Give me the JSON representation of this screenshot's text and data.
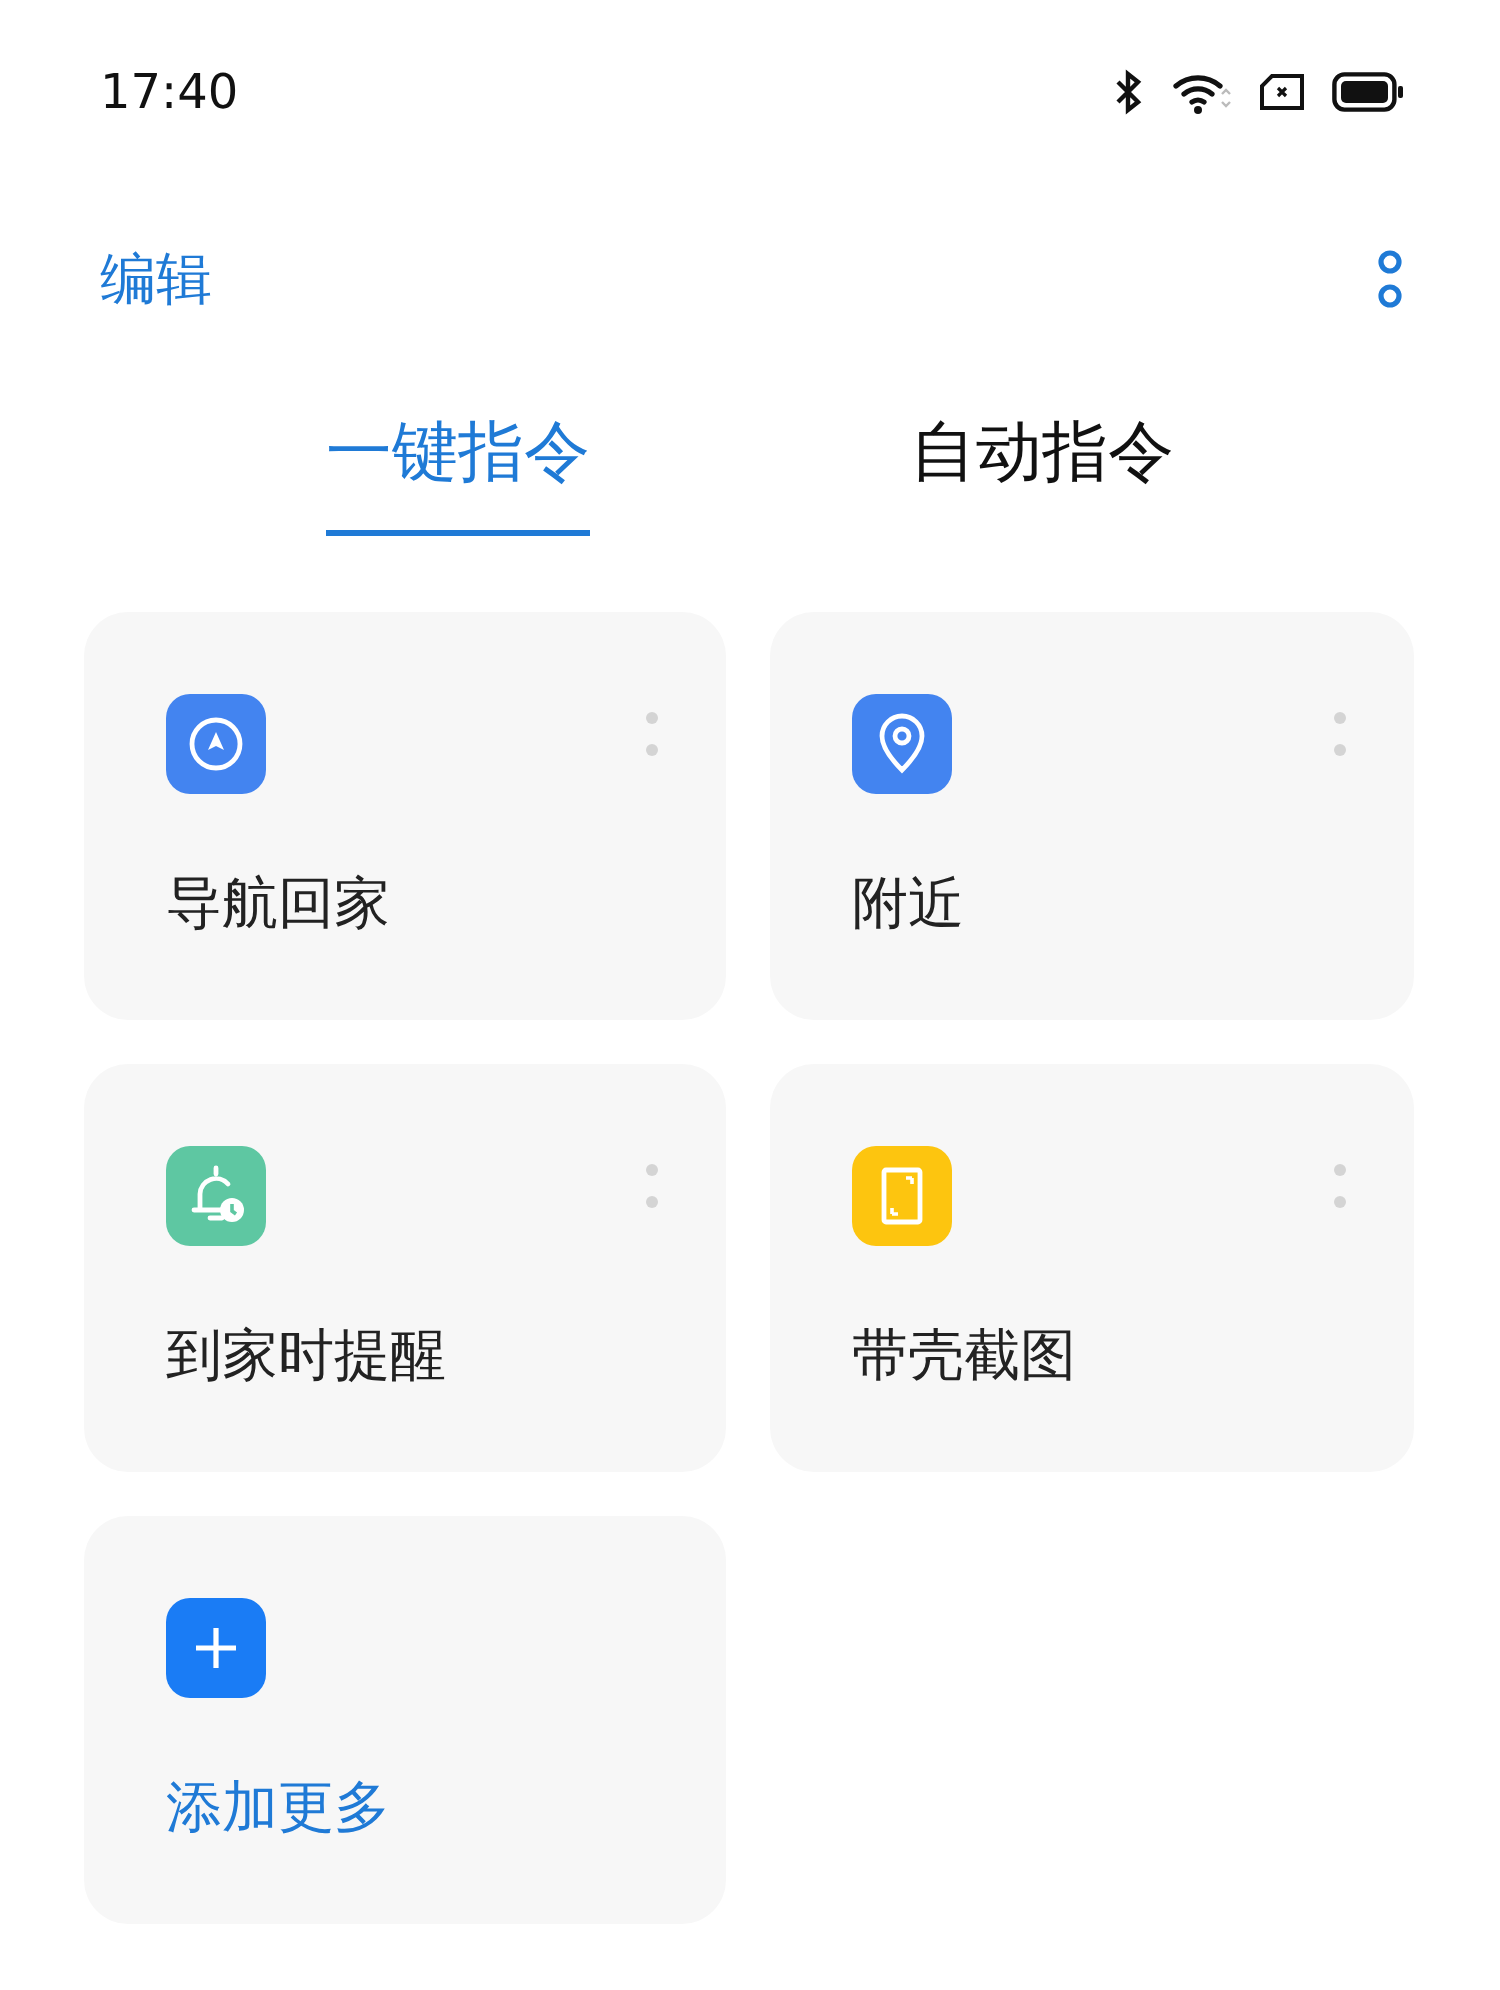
{
  "status_bar": {
    "time": "17:40"
  },
  "header": {
    "edit": "编辑"
  },
  "tabs": [
    {
      "label": "一键指令",
      "selected": true
    },
    {
      "label": "自动指令",
      "selected": false
    }
  ],
  "cards": [
    {
      "kind": "navigation",
      "label": "导航回家",
      "color": "#4384f0"
    },
    {
      "kind": "location",
      "label": "附近",
      "color": "#4384f0"
    },
    {
      "kind": "reminder",
      "label": "到家时提醒",
      "color": "#5ec7a2"
    },
    {
      "kind": "screenshot",
      "label": "带壳截图",
      "color": "#fdc50f"
    },
    {
      "kind": "add",
      "label": "添加更多",
      "color": "#1a7cf5"
    }
  ]
}
